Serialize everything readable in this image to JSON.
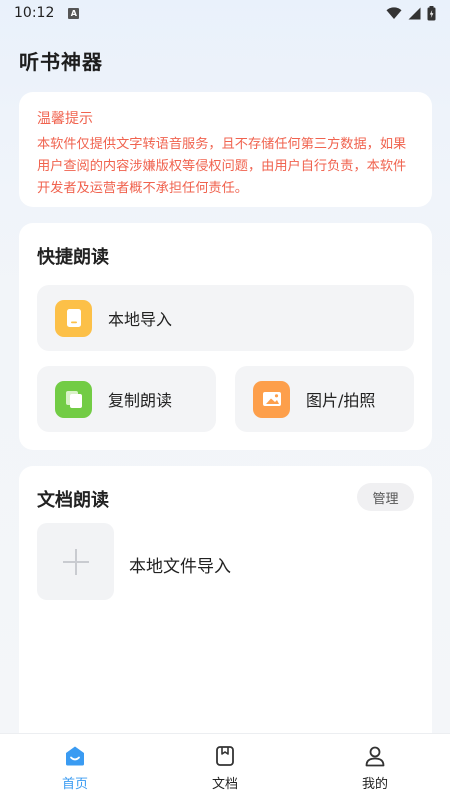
{
  "status_bar": {
    "time": "10:12",
    "notif_glyph": "A"
  },
  "app": {
    "title": "听书神器"
  },
  "notice": {
    "title": "温馨提示",
    "text": "本软件仅提供文字转语音服务，且不存储任何第三方数据，如果用户查阅的内容涉嫌版权等侵权问题，由用户自行负责，本软件开发者及运营者概不承担任何责任。",
    "color": "#f0634f"
  },
  "quick_read": {
    "title": "快捷朗读",
    "local_import": {
      "label": "本地导入",
      "icon": "document-icon",
      "color": "#fcc048"
    },
    "copy_read": {
      "label": "复制朗读",
      "icon": "copy-icon",
      "color": "#72cc45"
    },
    "image_photo": {
      "label": "图片/拍照",
      "icon": "image-icon",
      "color": "#fd9f4b"
    }
  },
  "doc_read": {
    "title": "文档朗读",
    "manage_label": "管理",
    "import_label": "本地文件导入"
  },
  "bottom_nav": {
    "home": "首页",
    "docs": "文档",
    "mine": "我的",
    "active_color": "#3a9bf2"
  }
}
